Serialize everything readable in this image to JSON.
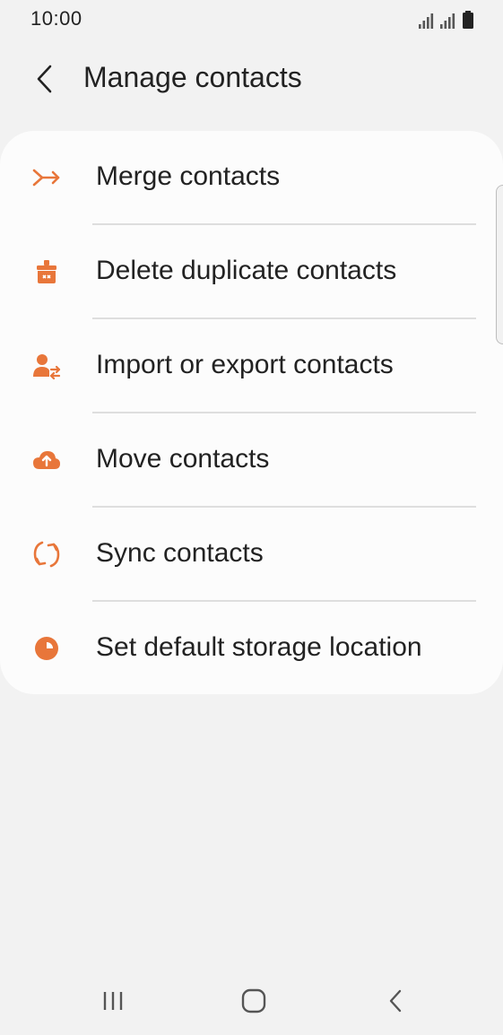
{
  "status_bar": {
    "time": "10:00",
    "icons": [
      "signal-icon",
      "signal-icon",
      "battery-icon"
    ]
  },
  "header": {
    "back_icon": "back-arrow-icon",
    "title": "Manage contacts"
  },
  "menu": {
    "accent_color": "#e8763a",
    "items": [
      {
        "label": "Merge contacts",
        "icon": "merge-icon"
      },
      {
        "label": "Delete duplicate contacts",
        "icon": "delete-duplicates-icon"
      },
      {
        "label": "Import or export contacts",
        "icon": "import-export-icon"
      },
      {
        "label": "Move contacts",
        "icon": "cloud-upload-icon"
      },
      {
        "label": "Sync contacts",
        "icon": "sync-icon"
      },
      {
        "label": "Set default storage location",
        "icon": "storage-pie-icon"
      }
    ]
  },
  "nav_bar": {
    "recents_icon": "recents-icon",
    "home_icon": "home-icon",
    "back_icon": "back-icon"
  }
}
